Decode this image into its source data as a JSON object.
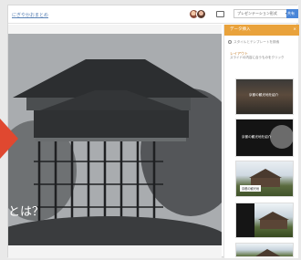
{
  "header": {
    "doc_title": "にぎやかおまとめ",
    "present_label": "プレゼンテーション形式",
    "present_caret": "▾",
    "share_label": "共有"
  },
  "slide": {
    "title_text": "とは？"
  },
  "panel": {
    "header_label": "データ挿入",
    "close_glyph": "×",
    "search_placeholder": "スタイルとテンプレートを検索",
    "layout_label": "レイアウト",
    "layout_desc": "スライドの内容に合うものをクリック",
    "thumbnails": [
      {
        "text": "京都の観光地を紹介"
      },
      {
        "text": "京都の観光地を紹介"
      },
      {
        "text": "京都の観光地"
      },
      {
        "text": ""
      },
      {
        "text": ""
      }
    ]
  },
  "icons": {
    "comment": "comment-icon",
    "search": "search-icon",
    "chevron": "chevron-up-icon"
  },
  "colors": {
    "accent_orange": "#e9a23b",
    "accent_red_arrow": "#e04830",
    "share_blue": "#4a86d8",
    "link_blue": "#5a82b5"
  }
}
